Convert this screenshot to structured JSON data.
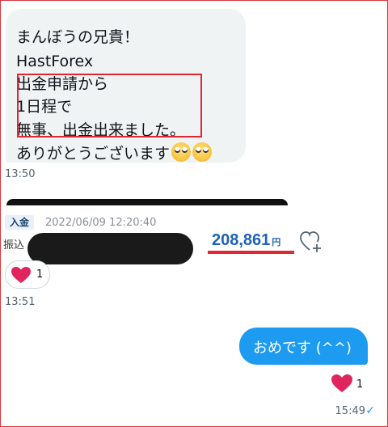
{
  "incoming_message": {
    "lines": [
      "まんぼうの兄貴！",
      "HastForex",
      "出金申請から",
      "1日程で",
      "無事、出金出来ました。",
      "ありがとうございます"
    ],
    "emoji": [
      "eye-roll-emoji",
      "eye-roll-emoji"
    ],
    "timestamp": "13:50"
  },
  "deposit_card": {
    "badge": "入金",
    "datetime": "2022/06/09 12:20:40",
    "sender_label": "振込",
    "amount": "208,861",
    "currency_symbol": "円",
    "reaction_count": "1",
    "timestamp": "13:51"
  },
  "outgoing_message": {
    "text": "おめです (^^)",
    "reaction_count": "1",
    "timestamp": "15:49"
  },
  "colors": {
    "highlight": "#e0262f",
    "accent": "#1d9bf0",
    "heart": "#e0245e",
    "amount": "#1e63b6"
  }
}
